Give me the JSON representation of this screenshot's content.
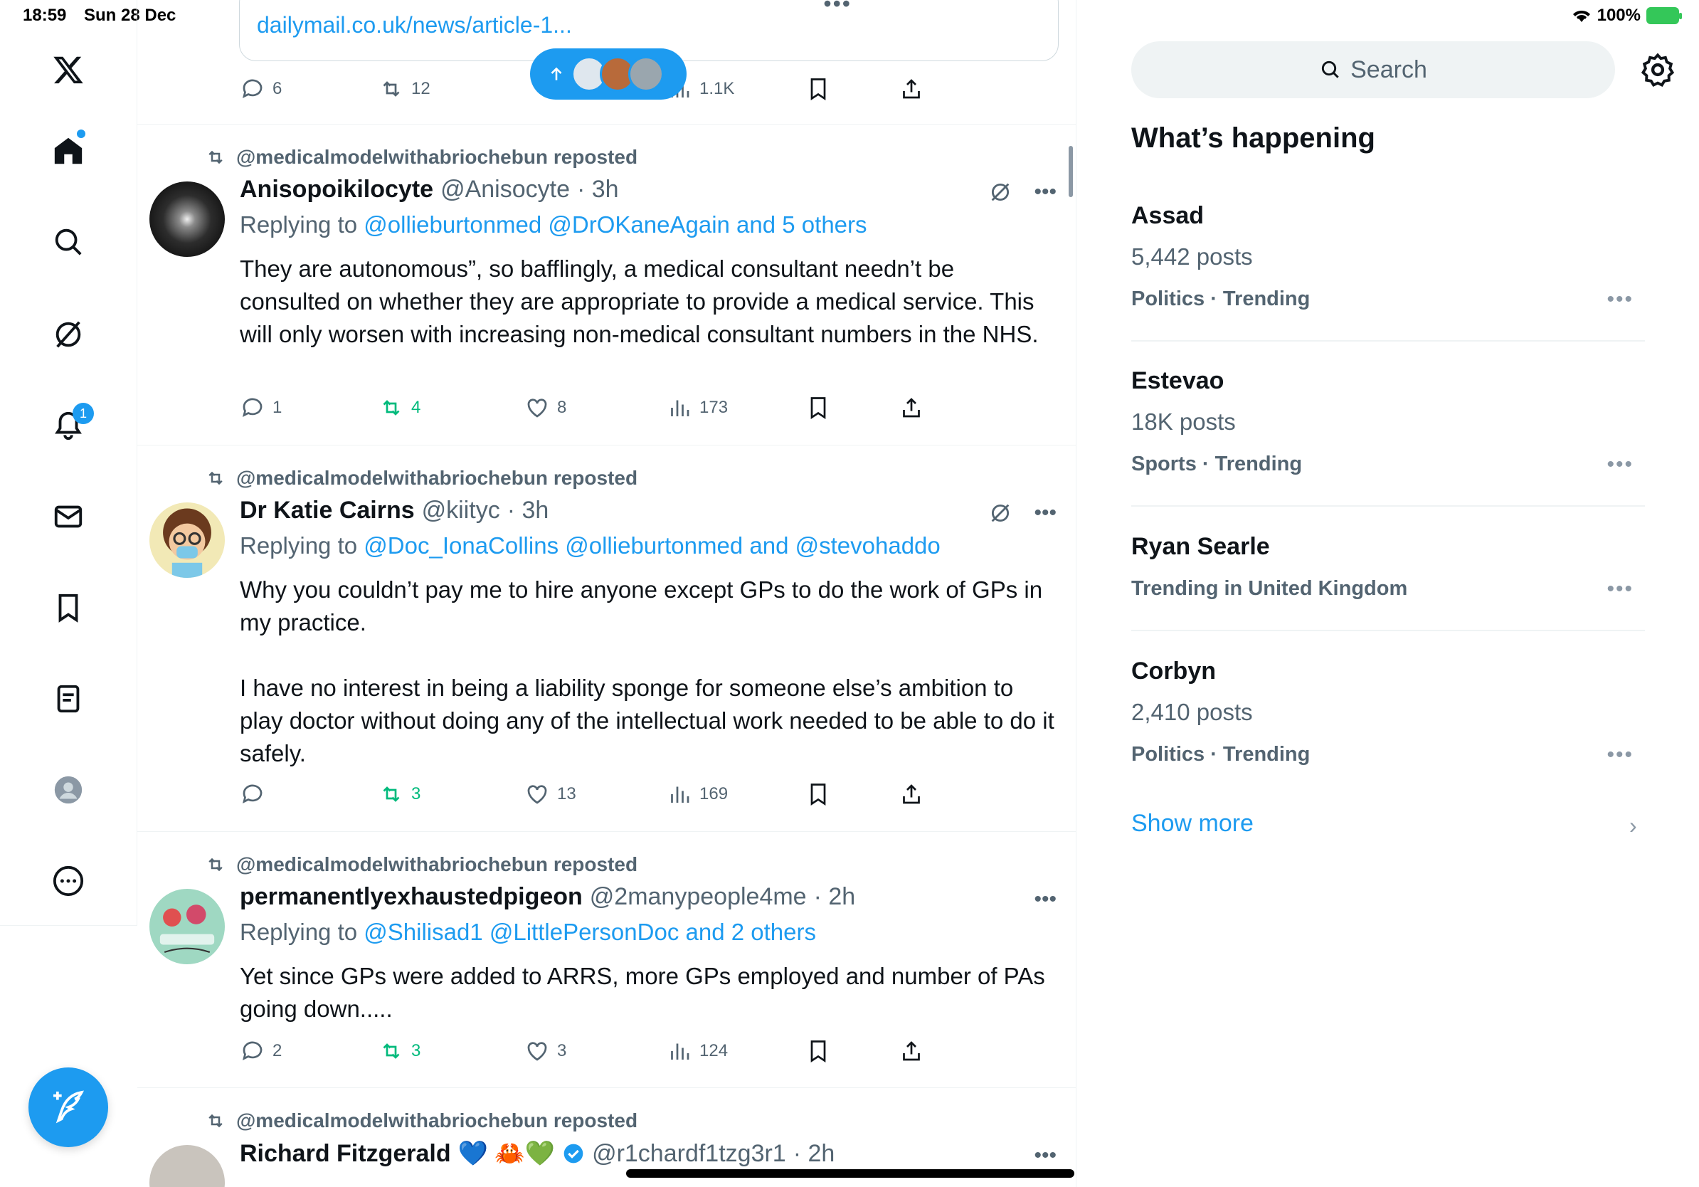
{
  "status_bar": {
    "time": "18:59",
    "date": "Sun 28 Dec",
    "battery": "100%"
  },
  "nav": {
    "notification_count": "1"
  },
  "top_card": {
    "url": "dailymail.co.uk/news/article-1...",
    "replies": "6",
    "reposts": "12",
    "views": "1.1K"
  },
  "tweets": [
    {
      "repost_by": "@medicalmodelwithabriochebun reposted",
      "name": "Anisopoikilocyte",
      "handle": "@Anisocyte",
      "time": "· 3h",
      "reply_prefix": "Replying to",
      "mentions": "@ollieburtonmed @DrOKaneAgain and 5 others",
      "text": "They are autonomous”, so bafflingly, a medical consultant needn’t be consulted on whether they are appropriate to provide a medical service. This will only worsen with increasing non-medical consultant numbers in the NHS.",
      "replies": "1",
      "reposts": "4",
      "likes": "8",
      "views": "173"
    },
    {
      "repost_by": "@medicalmodelwithabriochebun reposted",
      "name": "Dr Katie Cairns",
      "handle": "@kiityc",
      "time": "· 3h",
      "reply_prefix": "Replying to",
      "mentions": "@Doc_IonaCollins @ollieburtonmed and @stevohaddo",
      "text": "Why you couldn’t pay me to hire anyone except GPs to do the work of GPs in my practice.\n\nI have no interest in being a liability sponge for someone else’s ambition to play doctor without doing  any of the intellectual work needed to be able to do it safely.",
      "replies": "",
      "reposts": "3",
      "likes": "13",
      "views": "169"
    },
    {
      "repost_by": "@medicalmodelwithabriochebun reposted",
      "name": "permanentlyexhaustedpigeon",
      "handle": "@2manypeople4me",
      "time": "· 2h",
      "reply_prefix": "Replying to",
      "mentions": "@Shilisad1 @LittlePersonDoc and 2 others",
      "text": "Yet since GPs were added to ARRS, more GPs employed and number of PAs going down.....",
      "replies": "2",
      "reposts": "3",
      "likes": "3",
      "views": "124"
    },
    {
      "repost_by": "@medicalmodelwithabriochebun reposted",
      "name": "Richard Fitzgerald",
      "emojis": "💙 🦀💚",
      "handle": "@r1chardf1tzg3r1",
      "time": "· 2h"
    }
  ],
  "search": {
    "placeholder": "Search"
  },
  "trends_section": {
    "title": "What’s happening",
    "items": [
      {
        "name": "Assad",
        "count": "5,442 posts",
        "meta": "Politics · Trending"
      },
      {
        "name": "Estevao",
        "count": "18K posts",
        "meta": "Sports · Trending"
      },
      {
        "name": "Ryan Searle",
        "count": "",
        "meta": "Trending in United Kingdom"
      },
      {
        "name": "Corbyn",
        "count": "2,410 posts",
        "meta": "Politics · Trending"
      }
    ],
    "show_more": "Show more"
  },
  "colors": {
    "accent": "#1d9bf0",
    "repost_green": "#00ba7c",
    "muted": "#536471"
  }
}
